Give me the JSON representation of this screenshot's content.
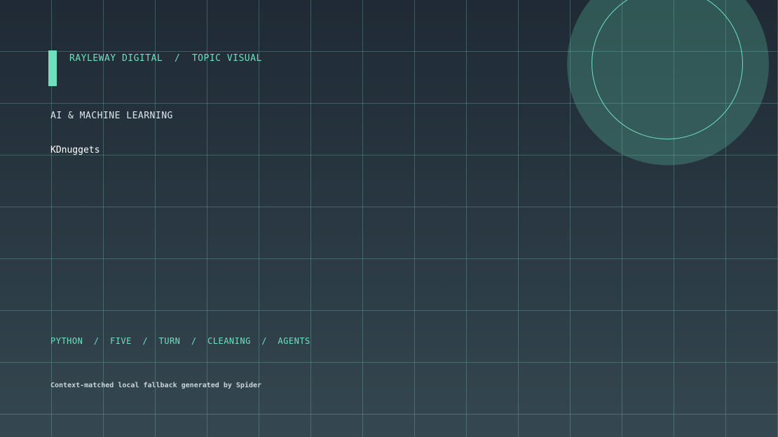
{
  "header": {
    "kicker": "RAYLEWAY DIGITAL  /  TOPIC VISUAL"
  },
  "main": {
    "category": "AI & MACHINE LEARNING",
    "source": "KDnuggets"
  },
  "tags": {
    "text": "PYTHON  /  FIVE  /  TURN  /  CLEANING  /  AGENTS"
  },
  "footer": {
    "note": "Context-matched local fallback generated by Spider"
  },
  "colors": {
    "accent": "#6fe0bd",
    "background_top": "#1f2a35",
    "background_bottom": "#354750"
  }
}
